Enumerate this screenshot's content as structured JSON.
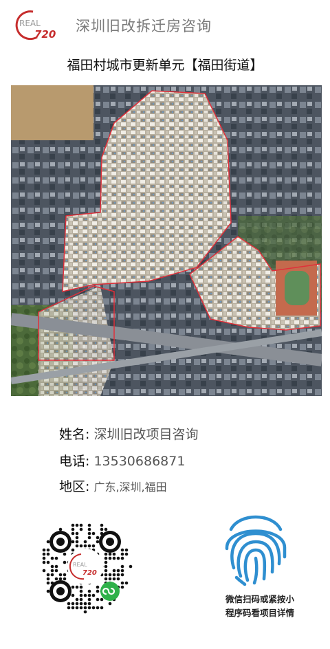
{
  "header": {
    "logo_text_top": "REAL",
    "logo_text_bottom": "720",
    "brand_name": "深圳旧改拆迁房咨询"
  },
  "title": "福田村城市更新单元【福田街道】",
  "contact": {
    "name_label": "姓名:",
    "name_value": "深圳旧改项目咨询",
    "phone_label": "电话:",
    "phone_value": "13530686871",
    "area_label": "地区:",
    "area_value": "广东,深圳,福田"
  },
  "qr": {
    "logo_top": "REAL",
    "logo_bottom": "720"
  },
  "fingerprint": {
    "caption_line1": "微信扫码或紧按小",
    "caption_line2": "程序码看项目详情"
  },
  "colors": {
    "brand_red": "#c62d2d",
    "fingerprint_blue": "#2f8fd0",
    "wechat_green": "#2fb14a"
  }
}
